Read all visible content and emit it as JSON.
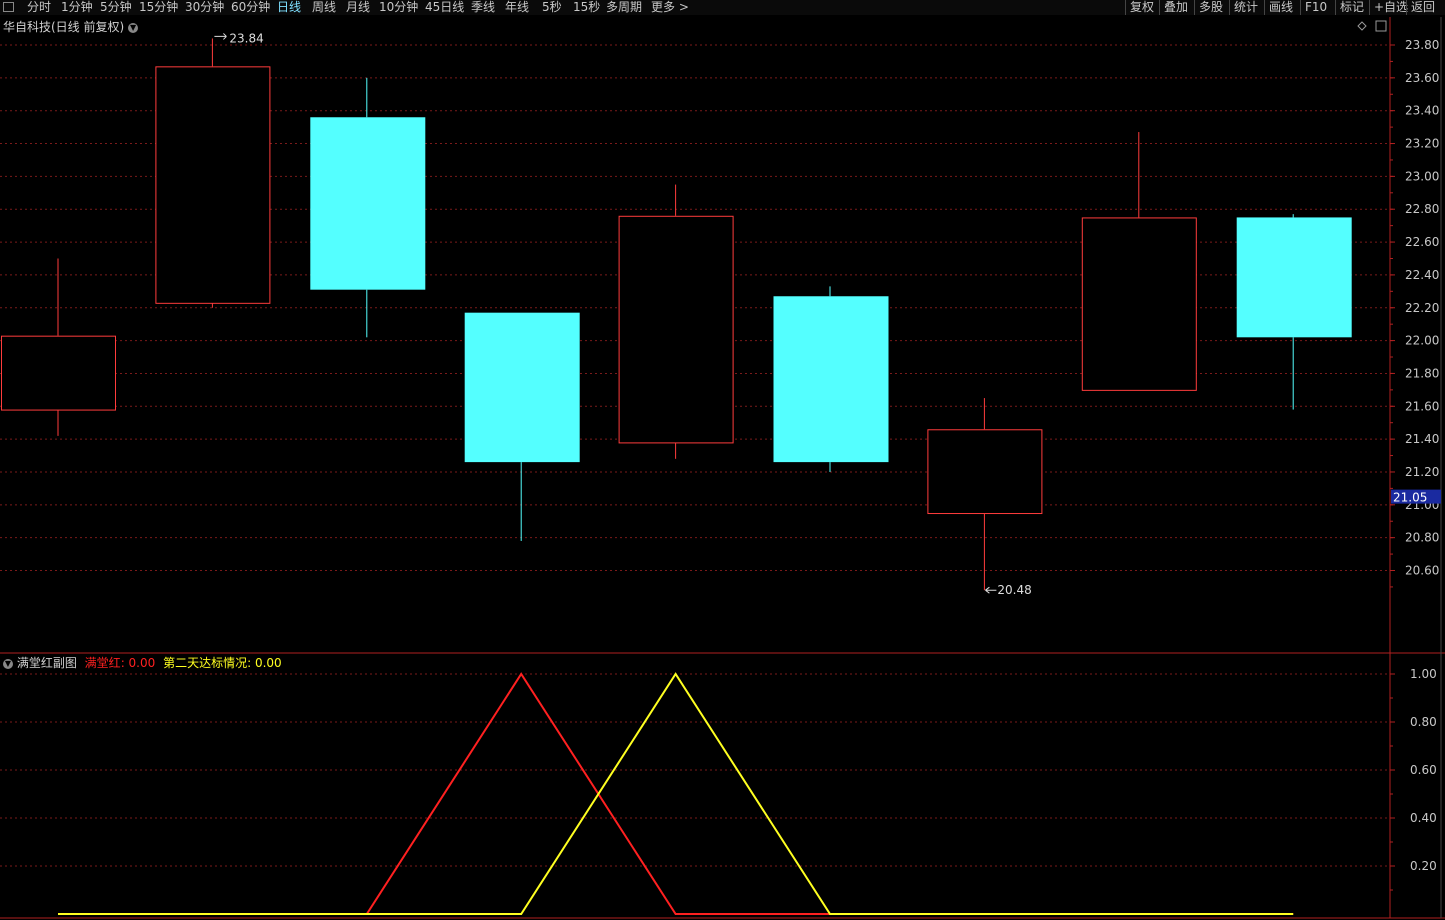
{
  "toolbar": {
    "periods": [
      "分时",
      "1分钟",
      "5分钟",
      "15分钟",
      "30分钟",
      "60分钟",
      "日线",
      "周线",
      "月线",
      "10分钟",
      "45日线",
      "季线",
      "年线",
      "5秒",
      "15秒",
      "多周期",
      "更多"
    ],
    "active_period": "日线",
    "more_arrow": ">",
    "right_buttons": [
      "复权",
      "叠加",
      "多股",
      "统计",
      "画线",
      "F10",
      "标记",
      "+自选",
      "返回"
    ]
  },
  "main_title": "华自科技(日线 前复权)",
  "sub_title": "满堂红副图",
  "sub_indicators": [
    {
      "name": "满堂红",
      "value": "0.00",
      "color": "#ff2020"
    },
    {
      "name": "第二天达标情况",
      "value": "0.00",
      "color": "#ffff20"
    }
  ],
  "colors": {
    "up": "#ff3c3c",
    "down": "#54ffff",
    "grid": "#7a1a1a",
    "axis": "#b02020",
    "price_tag_bg": "#1a2aa0"
  },
  "chart_data": [
    {
      "type": "candlestick",
      "title": "华自科技(日线 前复权)",
      "ylim": [
        20.4,
        23.92
      ],
      "y_ticks": [
        "23.80",
        "23.60",
        "23.40",
        "23.20",
        "23.00",
        "22.80",
        "22.60",
        "22.40",
        "22.20",
        "22.00",
        "21.80",
        "21.60",
        "21.40",
        "21.20",
        "21.00",
        "20.80",
        "20.60"
      ],
      "current_price": "21.05",
      "high_label": "23.84",
      "low_label": "20.48",
      "grid": true,
      "candles": [
        {
          "open": 21.58,
          "close": 22.03,
          "high": 22.5,
          "low": 21.42
        },
        {
          "open": 22.23,
          "close": 23.67,
          "high": 23.84,
          "low": 22.2
        },
        {
          "open": 23.36,
          "close": 22.31,
          "high": 23.6,
          "low": 22.02
        },
        {
          "open": 22.17,
          "close": 21.26,
          "high": 22.17,
          "low": 20.78
        },
        {
          "open": 21.38,
          "close": 22.76,
          "high": 22.95,
          "low": 21.28
        },
        {
          "open": 22.27,
          "close": 21.26,
          "high": 22.33,
          "low": 21.2
        },
        {
          "open": 20.95,
          "close": 21.46,
          "high": 21.65,
          "low": 20.48
        },
        {
          "open": 21.7,
          "close": 22.75,
          "high": 23.27,
          "low": 21.7
        },
        {
          "open": 22.75,
          "close": 22.02,
          "high": 22.77,
          "low": 21.58
        }
      ]
    },
    {
      "type": "line",
      "title": "满堂红副图",
      "ylim": [
        0,
        1.0
      ],
      "y_ticks": [
        "1.00",
        "0.80",
        "0.60",
        "0.40",
        "0.20"
      ],
      "grid": true,
      "series": [
        {
          "name": "满堂红",
          "color": "#ff2020",
          "values": [
            0,
            0,
            0,
            1,
            0,
            0,
            0,
            0,
            0
          ]
        },
        {
          "name": "第二天达标情况",
          "color": "#ffff20",
          "values": [
            0,
            0,
            0,
            0,
            1,
            0,
            0,
            0,
            0
          ]
        }
      ]
    }
  ]
}
